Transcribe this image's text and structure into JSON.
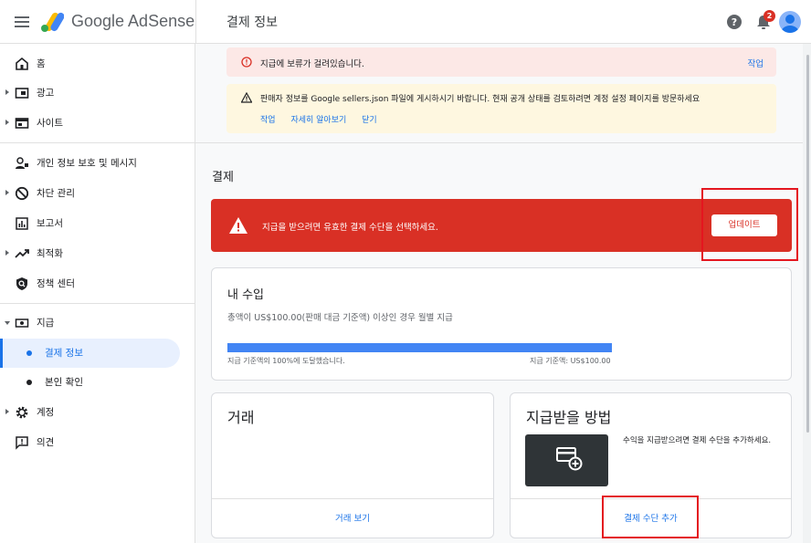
{
  "header": {
    "brand": "Google AdSense",
    "page_title": "결제 정보",
    "notification_count": "2"
  },
  "sidebar": {
    "items": [
      {
        "label": "홈"
      },
      {
        "label": "광고"
      },
      {
        "label": "사이트"
      },
      {
        "label": "개인 정보 보호 및 메시지"
      },
      {
        "label": "차단 관리"
      },
      {
        "label": "보고서"
      },
      {
        "label": "최적화"
      },
      {
        "label": "정책 센터"
      },
      {
        "label": "지급"
      },
      {
        "label": "계정"
      },
      {
        "label": "의견"
      }
    ],
    "payments_sub": [
      {
        "label": "결제 정보",
        "active": true
      },
      {
        "label": "본인 확인",
        "active": false
      }
    ]
  },
  "alerts": {
    "hold": {
      "text": "지급에 보류가 걸려있습니다.",
      "action": "작업"
    },
    "sellers": {
      "text": "판매자 정보를 Google sellers.json 파일에 게시하시기 바랍니다. 현재 공개 상태를 검토하려면 계정 설정 페이지를 방문하세요",
      "links": [
        "작업",
        "자세히 알아보기",
        "닫기"
      ]
    }
  },
  "payments": {
    "section_title": "결제",
    "banner": {
      "text": "지급을 받으려면 유효한 결제 수단을 선택하세요.",
      "button": "업데이트"
    },
    "earnings": {
      "title": "내 수입",
      "subtitle": "총액이 US$100.00(판매 대금 기준액) 이상인 경우 월별 지급",
      "progress_percent": 100,
      "progress_left": "지급 기준액의 100%에 도달했습니다.",
      "progress_right": "지급 기준액: US$100.00"
    },
    "transactions": {
      "title": "거래",
      "link": "거래 보기"
    },
    "method": {
      "title": "지급받을 방법",
      "description": "수익을 지급받으려면 결제 수단을 추가하세요.",
      "link": "결제 수단 추가"
    }
  },
  "colors": {
    "accent": "#1a73e8",
    "error": "#d93025",
    "warning_bg": "#fef7e0",
    "error_bg": "#fce8e6",
    "highlight": "#e4161f"
  }
}
